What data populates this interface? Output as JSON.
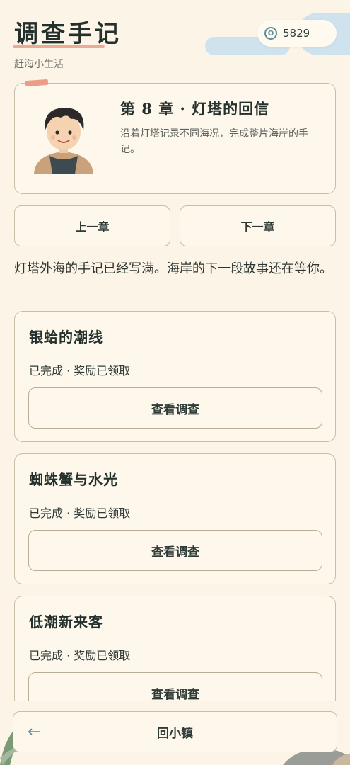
{
  "header": {
    "title": "调查手记",
    "subtitle": "赶海小生活",
    "coins": "5829"
  },
  "chapter": {
    "title": "第 8 章 · 灯塔的回信",
    "description": "沿着灯塔记录不同海况，完成整片海岸的手记。"
  },
  "nav": {
    "prev_label": "上一章",
    "next_label": "下一章"
  },
  "intro_text": "灯塔外海的手记已经写满。海岸的下一段故事还在等你。",
  "quests": [
    {
      "title": "银蛤的潮线",
      "status": "已完成 · 奖励已领取",
      "button": "查看调查"
    },
    {
      "title": "蜘蛛蟹与水光",
      "status": "已完成 · 奖励已领取",
      "button": "查看调查"
    },
    {
      "title": "低潮新来客",
      "status": "已完成 · 奖励已领取",
      "button": "查看调查"
    }
  ],
  "bottom": {
    "back_label": "回小镇"
  },
  "icons": {
    "coin": "coin-icon",
    "back": "arrow-left-icon"
  },
  "colors": {
    "background": "#fcf4e6",
    "card_border": "#c9bda8",
    "accent_teal": "#5f8e96",
    "accent_coral": "#ea9c86"
  }
}
